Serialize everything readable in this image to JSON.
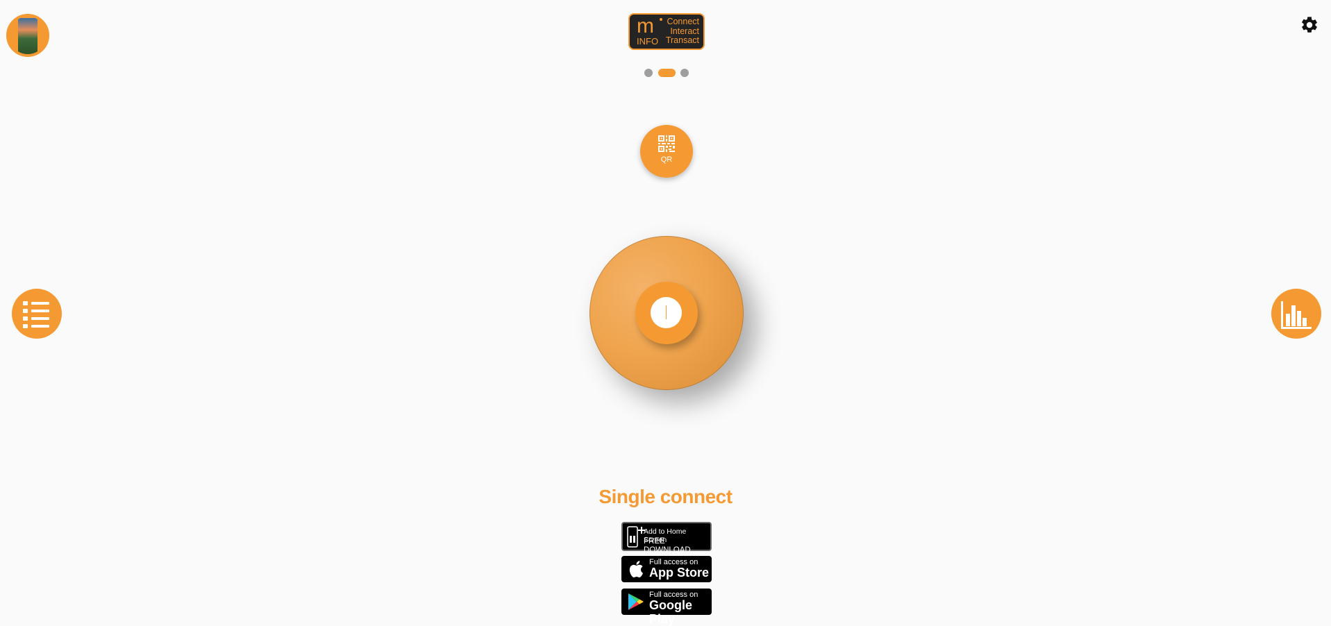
{
  "header": {
    "logo": {
      "mark": "m",
      "sub": "INFO",
      "tagline": [
        "Connect",
        "Interact",
        "Transact"
      ]
    },
    "pager": {
      "count": 3,
      "active_index": 1
    }
  },
  "qr_button": {
    "label": "QR"
  },
  "dial": {
    "value": ""
  },
  "mode_label": "Single connect",
  "badges": {
    "home": {
      "line1": "Add to Home Screen",
      "line2": "FREE DOWNLOAD"
    },
    "apple": {
      "small": "Full access on",
      "big": "App Store"
    },
    "google": {
      "small": "Full access on",
      "big": "Google Play"
    }
  },
  "colors": {
    "accent": "#f59a32",
    "background": "#fafafa",
    "dark": "#242424"
  },
  "icons": {
    "settings": "gear-icon",
    "menu": "list-icon",
    "stats": "bar-chart-icon",
    "qr": "qr-code-icon",
    "apple": "apple-icon",
    "google": "google-play-icon",
    "home": "phone-icon"
  }
}
